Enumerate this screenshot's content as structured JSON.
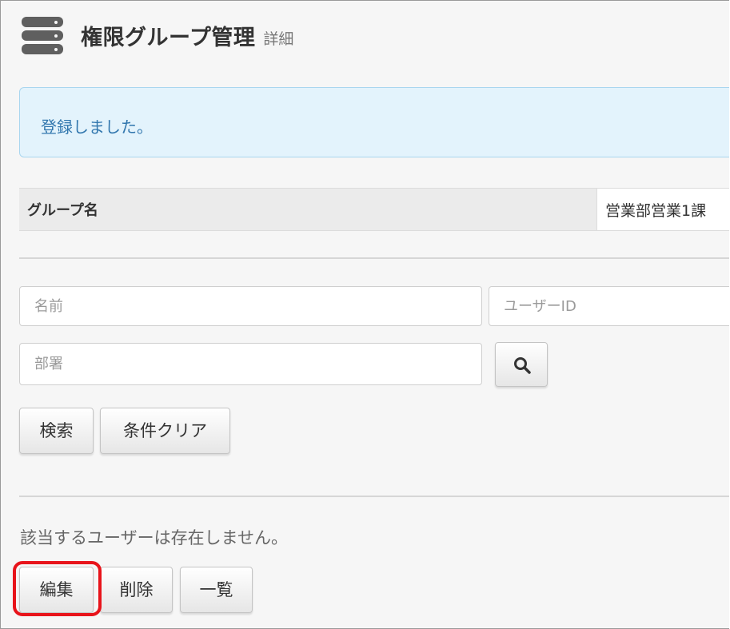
{
  "header": {
    "icon": "database-icon",
    "title": "権限グループ管理",
    "subtitle": "詳細"
  },
  "alert": {
    "message": "登録しました。",
    "color": "#3277ae"
  },
  "group_info": {
    "label": "グループ名",
    "value": "営業部営業1課"
  },
  "search": {
    "name_placeholder": "名前",
    "user_id_placeholder": "ユーザーID",
    "department_placeholder": "部署",
    "lookup_icon": "search-icon",
    "search_label": "検索",
    "clear_label": "条件クリア"
  },
  "results": {
    "empty_message": "該当するユーザーは存在しません。"
  },
  "actions": {
    "edit_label": "編集",
    "delete_label": "削除",
    "list_label": "一覧",
    "highlight_color": "#e8141b"
  }
}
